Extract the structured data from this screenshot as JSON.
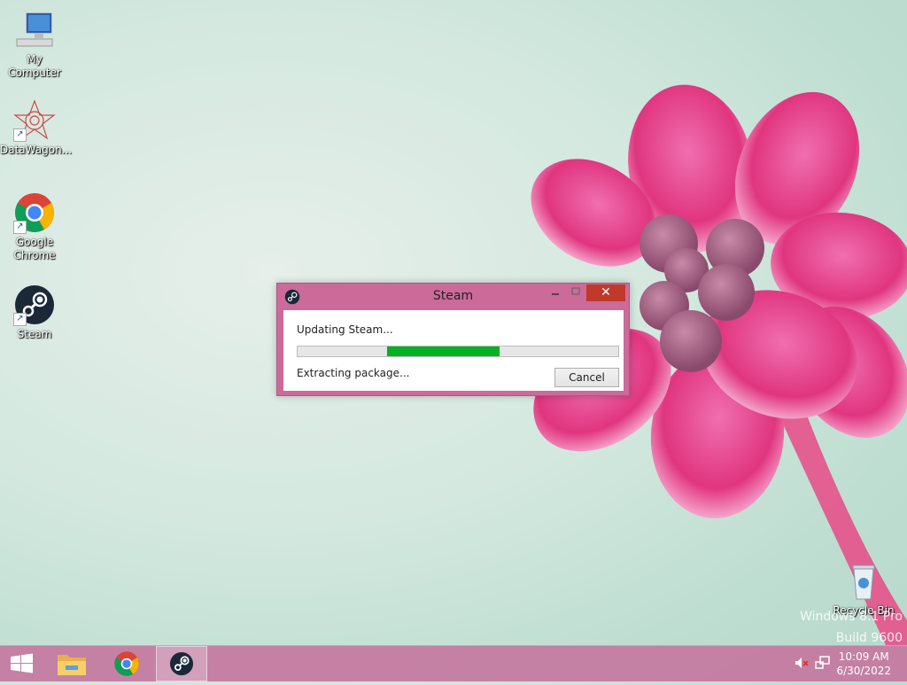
{
  "desktop": {
    "icons": [
      {
        "label": "My Computer"
      },
      {
        "label": "DataWagon..."
      },
      {
        "label": "Google Chrome"
      },
      {
        "label": "Steam"
      },
      {
        "label": "Recycle Bin"
      }
    ],
    "watermark": {
      "line1": "Windows 8.1 Pro",
      "line2": "Build 9600"
    }
  },
  "steam_dialog": {
    "title": "Steam",
    "status": "Updating Steam...",
    "detail": "Extracting package...",
    "cancel_label": "Cancel",
    "close_glyph": "✕",
    "progress": {
      "start_fraction": 0.28,
      "end_fraction": 0.63
    }
  },
  "taskbar": {
    "time": "10:09 AM",
    "date": "6/30/2022"
  },
  "colors": {
    "titlebar": "#cc6a9a",
    "taskbar": "#c478a0",
    "progress": "#06b025",
    "close_button": "#c0392b"
  },
  "icons": [
    "computer-icon",
    "datawagon-icon",
    "chrome-icon",
    "steam-icon",
    "recycle-bin-icon",
    "windows-start-icon",
    "file-explorer-icon",
    "volume-muted-icon",
    "network-icon"
  ]
}
